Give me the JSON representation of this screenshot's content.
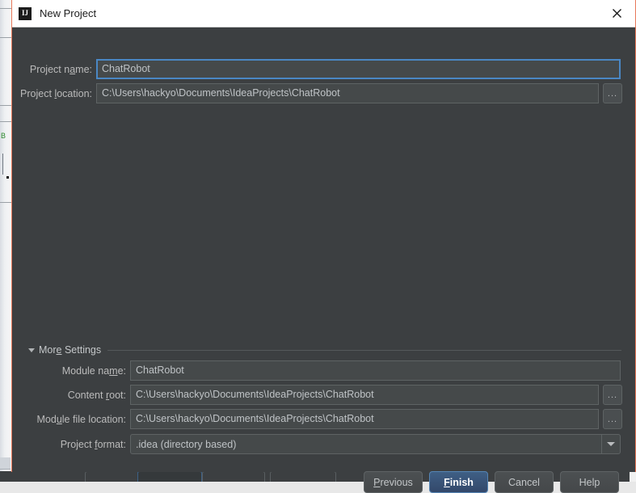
{
  "window": {
    "title": "New Project",
    "icon": "intellij-idea-icon",
    "icon_text": "IJ",
    "close_icon": "close-icon",
    "border_color": "#e8795a",
    "titlebar_bg": "#ffffff",
    "body_bg": "#3c3f41"
  },
  "form": {
    "project_name": {
      "label_pre": "Project n",
      "label_mnemonic": "a",
      "label_post": "me:",
      "value": "ChatRobot",
      "focused": true
    },
    "project_location": {
      "label_pre": "Project ",
      "label_mnemonic": "l",
      "label_post": "ocation:",
      "value": "C:\\Users\\hackyo\\Documents\\IdeaProjects\\ChatRobot",
      "browse_label": "..."
    }
  },
  "more_settings": {
    "label_pre": "Mor",
    "label_mnemonic": "e",
    "label_post": " Settings",
    "expanded": true,
    "toggle_icon": "triangle-down-icon",
    "fields": {
      "module_name": {
        "label_pre": "Module na",
        "label_mnemonic": "m",
        "label_post": "e:",
        "value": "ChatRobot"
      },
      "content_root": {
        "label_pre": "Content ",
        "label_mnemonic": "r",
        "label_post": "oot:",
        "value": "C:\\Users\\hackyo\\Documents\\IdeaProjects\\ChatRobot",
        "browse_label": "..."
      },
      "module_file_location": {
        "label_pre": "Mod",
        "label_mnemonic": "u",
        "label_post": "le file location:",
        "value": "C:\\Users\\hackyo\\Documents\\IdeaProjects\\ChatRobot",
        "browse_label": "..."
      },
      "project_format": {
        "label_pre": "Project ",
        "label_mnemonic": "f",
        "label_post": "ormat:",
        "value": ".idea (directory based)",
        "arrow_icon": "chevron-down-icon"
      }
    }
  },
  "buttons": {
    "previous": {
      "pre": "",
      "mnemonic": "P",
      "post": "revious",
      "default": false
    },
    "finish": {
      "pre": "",
      "mnemonic": "F",
      "post": "inish",
      "default": true
    },
    "cancel": {
      "pre": "Cancel",
      "mnemonic": "",
      "post": "",
      "default": false
    },
    "help": {
      "pre": "Help",
      "mnemonic": "",
      "post": "",
      "default": false
    }
  },
  "background": {
    "left_glyph": "B",
    "accent_blue": "#3a7bbf"
  }
}
